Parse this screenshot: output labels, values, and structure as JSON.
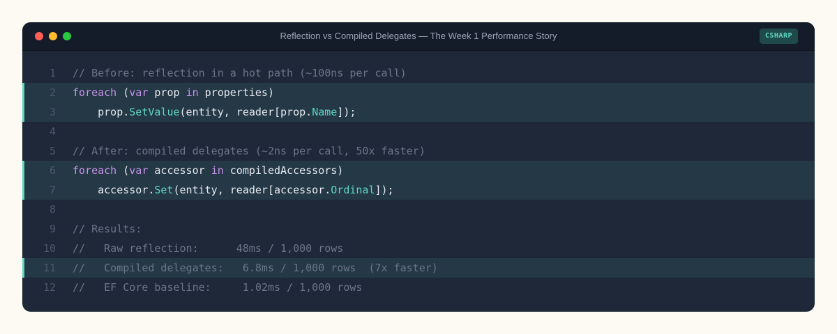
{
  "window": {
    "title": "Reflection vs Compiled Delegates — The Week 1 Performance Story",
    "language_badge": "CSHARP"
  },
  "colors": {
    "page_bg": "#fdfaf3",
    "editor_bg": "#1f2838",
    "titlebar_bg": "#151c29",
    "highlight_bg": "#243846",
    "highlight_accent": "#5fd6c2",
    "keyword": "#c792ea",
    "member": "#5fd6c2",
    "comment": "#6b7589",
    "text": "#e6e9ef",
    "line_number": "#4c586b"
  },
  "code": {
    "lines": [
      {
        "number": "1",
        "highlighted": false,
        "tokens": [
          {
            "type": "comment",
            "text": "// Before: reflection in a hot path (~100ns per call)"
          }
        ]
      },
      {
        "number": "2",
        "highlighted": true,
        "tokens": [
          {
            "type": "keyword",
            "text": "foreach"
          },
          {
            "type": "plain",
            "text": " ("
          },
          {
            "type": "keyword",
            "text": "var"
          },
          {
            "type": "plain",
            "text": " prop "
          },
          {
            "type": "keyword",
            "text": "in"
          },
          {
            "type": "plain",
            "text": " properties)"
          }
        ]
      },
      {
        "number": "3",
        "highlighted": true,
        "tokens": [
          {
            "type": "plain",
            "text": "    prop."
          },
          {
            "type": "member",
            "text": "SetValue"
          },
          {
            "type": "plain",
            "text": "(entity, reader[prop."
          },
          {
            "type": "member",
            "text": "Name"
          },
          {
            "type": "plain",
            "text": "]);"
          }
        ]
      },
      {
        "number": "4",
        "highlighted": false,
        "tokens": []
      },
      {
        "number": "5",
        "highlighted": false,
        "tokens": [
          {
            "type": "comment",
            "text": "// After: compiled delegates (~2ns per call, 50x faster)"
          }
        ]
      },
      {
        "number": "6",
        "highlighted": true,
        "tokens": [
          {
            "type": "keyword",
            "text": "foreach"
          },
          {
            "type": "plain",
            "text": " ("
          },
          {
            "type": "keyword",
            "text": "var"
          },
          {
            "type": "plain",
            "text": " accessor "
          },
          {
            "type": "keyword",
            "text": "in"
          },
          {
            "type": "plain",
            "text": " compiledAccessors)"
          }
        ]
      },
      {
        "number": "7",
        "highlighted": true,
        "tokens": [
          {
            "type": "plain",
            "text": "    accessor."
          },
          {
            "type": "member",
            "text": "Set"
          },
          {
            "type": "plain",
            "text": "(entity, reader[accessor."
          },
          {
            "type": "member",
            "text": "Ordinal"
          },
          {
            "type": "plain",
            "text": "]);"
          }
        ]
      },
      {
        "number": "8",
        "highlighted": false,
        "tokens": []
      },
      {
        "number": "9",
        "highlighted": false,
        "tokens": [
          {
            "type": "comment",
            "text": "// Results:"
          }
        ]
      },
      {
        "number": "10",
        "highlighted": false,
        "tokens": [
          {
            "type": "comment",
            "text": "//   Raw reflection:      48ms / 1,000 rows"
          }
        ]
      },
      {
        "number": "11",
        "highlighted": true,
        "tokens": [
          {
            "type": "comment",
            "text": "//   Compiled delegates:   6.8ms / 1,000 rows  (7x faster)"
          }
        ]
      },
      {
        "number": "12",
        "highlighted": false,
        "tokens": [
          {
            "type": "comment",
            "text": "//   EF Core baseline:     1.02ms / 1,000 rows"
          }
        ]
      }
    ]
  }
}
